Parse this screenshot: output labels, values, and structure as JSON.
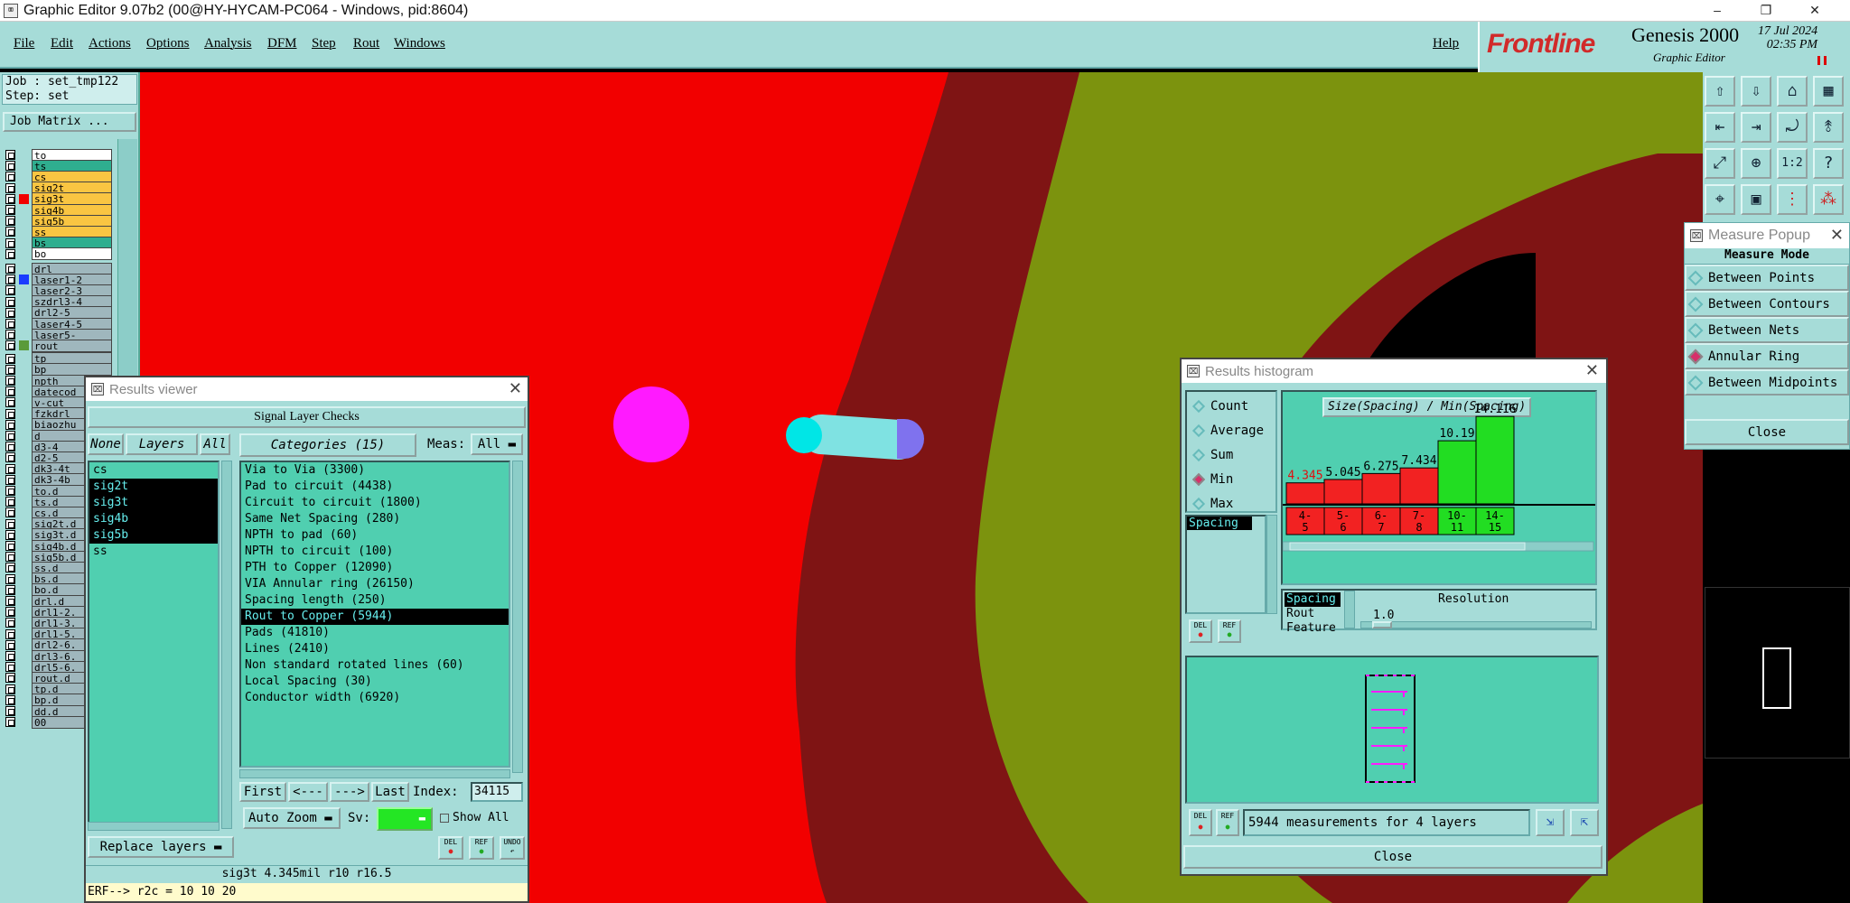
{
  "window": {
    "title": "Graphic Editor 9.07b2 (00@HY-HYCAM-PC064 - Windows, pid:8604)",
    "minimize": "–",
    "restore": "❐",
    "close": "✕"
  },
  "menu": [
    "File",
    "Edit",
    "Actions",
    "Options",
    "Analysis",
    "DFM",
    "Step",
    "Rout",
    "Windows"
  ],
  "help": "Help",
  "brand": {
    "logo": "Frontline",
    "product": "Genesis 2000",
    "subtitle": "Graphic Editor",
    "date": "17 Jul 2024",
    "time": "02:35 PM"
  },
  "job": {
    "job_line": "Job : set_tmp122",
    "step_line": "Step: set",
    "matrix_button": "Job Matrix ..."
  },
  "layers": [
    {
      "name": "to",
      "bg": "#ffffff",
      "color": ""
    },
    {
      "name": "ts",
      "bg": "#2fae8f",
      "color": ""
    },
    {
      "name": "cs",
      "bg": "#f9c542",
      "color": ""
    },
    {
      "name": "sig2t",
      "bg": "#f9c542",
      "color": ""
    },
    {
      "name": "sig3t",
      "bg": "#f9c542",
      "color": "#f20000"
    },
    {
      "name": "sig4b",
      "bg": "#f9c542",
      "color": ""
    },
    {
      "name": "sig5b",
      "bg": "#f9c542",
      "color": ""
    },
    {
      "name": "ss",
      "bg": "#f9c542",
      "color": ""
    },
    {
      "name": "bs",
      "bg": "#2fae8f",
      "color": ""
    },
    {
      "name": "bo",
      "bg": "#ffffff",
      "color": ""
    },
    {
      "name": "drl",
      "bg": "#9fb7bd",
      "color": ""
    },
    {
      "name": "laser1-2",
      "bg": "#9fb7bd",
      "color": "#1a3cff"
    },
    {
      "name": "laser2-3",
      "bg": "#9fb7bd",
      "color": ""
    },
    {
      "name": "szdrl3-4",
      "bg": "#9fb7bd",
      "color": ""
    },
    {
      "name": "drl2-5",
      "bg": "#9fb7bd",
      "color": ""
    },
    {
      "name": "laser4-5",
      "bg": "#9fb7bd",
      "color": ""
    },
    {
      "name": "laser5-",
      "bg": "#9fb7bd",
      "color": ""
    },
    {
      "name": "rout",
      "bg": "#9fb7bd",
      "color": "#5a9a3a"
    },
    {
      "name": "tp",
      "bg": "#9fb7bd",
      "color": ""
    },
    {
      "name": "bp",
      "bg": "#9fb7bd",
      "color": ""
    },
    {
      "name": "npth",
      "bg": "#9fb7bd",
      "color": ""
    },
    {
      "name": "datecod",
      "bg": "#9fb7bd",
      "color": ""
    },
    {
      "name": "v-cut",
      "bg": "#9fb7bd",
      "color": ""
    },
    {
      "name": "fzkdrl",
      "bg": "#9fb7bd",
      "color": ""
    },
    {
      "name": "biaozhu",
      "bg": "#9fb7bd",
      "color": ""
    },
    {
      "name": "d",
      "bg": "#9fb7bd",
      "color": ""
    },
    {
      "name": "d3-4",
      "bg": "#9fb7bd",
      "color": ""
    },
    {
      "name": "d2-5",
      "bg": "#9fb7bd",
      "color": ""
    },
    {
      "name": "dk3-4t",
      "bg": "#9fb7bd",
      "color": ""
    },
    {
      "name": "dk3-4b",
      "bg": "#9fb7bd",
      "color": ""
    },
    {
      "name": "to.d",
      "bg": "#9fb7bd",
      "color": ""
    },
    {
      "name": "ts.d",
      "bg": "#9fb7bd",
      "color": ""
    },
    {
      "name": "cs.d",
      "bg": "#9fb7bd",
      "color": ""
    },
    {
      "name": "sig2t.d",
      "bg": "#9fb7bd",
      "color": ""
    },
    {
      "name": "sig3t.d",
      "bg": "#9fb7bd",
      "color": ""
    },
    {
      "name": "sig4b.d",
      "bg": "#9fb7bd",
      "color": ""
    },
    {
      "name": "sig5b.d",
      "bg": "#9fb7bd",
      "color": ""
    },
    {
      "name": "ss.d",
      "bg": "#9fb7bd",
      "color": ""
    },
    {
      "name": "bs.d",
      "bg": "#9fb7bd",
      "color": ""
    },
    {
      "name": "bo.d",
      "bg": "#9fb7bd",
      "color": ""
    },
    {
      "name": "drl.d",
      "bg": "#9fb7bd",
      "color": ""
    },
    {
      "name": "drl1-2.",
      "bg": "#9fb7bd",
      "color": ""
    },
    {
      "name": "drl1-3.",
      "bg": "#9fb7bd",
      "color": ""
    },
    {
      "name": "drl1-5.",
      "bg": "#9fb7bd",
      "color": ""
    },
    {
      "name": "drl2-6.",
      "bg": "#9fb7bd",
      "color": ""
    },
    {
      "name": "drl3-6.",
      "bg": "#9fb7bd",
      "color": ""
    },
    {
      "name": "drl5-6.",
      "bg": "#9fb7bd",
      "color": ""
    },
    {
      "name": "rout.d",
      "bg": "#9fb7bd",
      "color": ""
    },
    {
      "name": "tp.d",
      "bg": "#9fb7bd",
      "color": ""
    },
    {
      "name": "bp.d",
      "bg": "#9fb7bd",
      "color": ""
    },
    {
      "name": "dd.d",
      "bg": "#9fb7bd",
      "color": ""
    },
    {
      "name": "00",
      "bg": "#9fb7bd",
      "color": ""
    }
  ],
  "results_viewer": {
    "title": "Results viewer",
    "section": "Signal Layer Checks",
    "none_btn": "None",
    "layers_btn": "Layers",
    "all_btn": "All",
    "categories_btn": "Categories (15)",
    "meas_label": "Meas:",
    "meas_value": "All",
    "layer_items": [
      {
        "name": "cs",
        "selected": false
      },
      {
        "name": "sig2t",
        "selected": true
      },
      {
        "name": "sig3t",
        "selected": true
      },
      {
        "name": "sig4b",
        "selected": true
      },
      {
        "name": "sig5b",
        "selected": true
      },
      {
        "name": "ss",
        "selected": false
      }
    ],
    "categories": [
      {
        "name": "Via to Via (3300)",
        "selected": false
      },
      {
        "name": "Pad to circuit (4438)",
        "selected": false
      },
      {
        "name": "Circuit to circuit (1800)",
        "selected": false
      },
      {
        "name": "Same Net Spacing (280)",
        "selected": false
      },
      {
        "name": "NPTH to pad (60)",
        "selected": false
      },
      {
        "name": "NPTH to circuit (100)",
        "selected": false
      },
      {
        "name": "PTH to Copper (12090)",
        "selected": false
      },
      {
        "name": "VIA Annular ring (26150)",
        "selected": false
      },
      {
        "name": "Spacing length (250)",
        "selected": false
      },
      {
        "name": "Rout to Copper (5944)",
        "selected": true
      },
      {
        "name": "Pads (41810)",
        "selected": false
      },
      {
        "name": "Lines (2410)",
        "selected": false
      },
      {
        "name": "Non standard rotated lines (60)",
        "selected": false
      },
      {
        "name": "Local Spacing (30)",
        "selected": false
      },
      {
        "name": "Conductor width (6920)",
        "selected": false
      }
    ],
    "first_btn": "First",
    "prev_btn": "<---",
    "next_btn": "--->",
    "last_btn": "Last",
    "index_label": "Index:",
    "index_value": "34115",
    "autozoom": "Auto Zoom",
    "sv_label": "Sv:",
    "show_all": "Show All",
    "replace_layers": "Replace layers",
    "del": "DEL",
    "ref": "REF",
    "undo": "UNDO",
    "status": "sig3t 4.345mil  r10  r16.5",
    "erf": "ERF--> r2c = 10 10 20"
  },
  "measure_popup": {
    "title": "Measure Popup",
    "mode_label": "Measure Mode",
    "options": [
      {
        "label": "Between Points",
        "on": false
      },
      {
        "label": "Between Contours",
        "on": false
      },
      {
        "label": "Between Nets",
        "on": false
      },
      {
        "label": "Annular Ring",
        "on": true
      },
      {
        "label": "Between Midpoints",
        "on": false
      }
    ],
    "close": "Close"
  },
  "histogram": {
    "title": "Results histogram",
    "stats": [
      {
        "label": "Count",
        "on": false
      },
      {
        "label": "Average",
        "on": false
      },
      {
        "label": "Sum",
        "on": false
      },
      {
        "label": "Min",
        "on": true
      },
      {
        "label": "Max",
        "on": false
      }
    ],
    "spacing_item": "Spacing",
    "chart_title": "Size(Spacing) / Min(Spacing)",
    "types": [
      "Spacing",
      "Rout",
      "Feature"
    ],
    "resolution_label": "Resolution",
    "resolution_value": "1.0",
    "summary": "5944 measurements for 4 layers",
    "close": "Close",
    "del": "DEL",
    "ref": "REF"
  },
  "chart_data": {
    "type": "bar",
    "title": "Size(Spacing) / Min(Spacing)",
    "categories": [
      "4-5",
      "5-6",
      "6-7",
      "7-8",
      "10-11",
      "14-15"
    ],
    "values": [
      4.345,
      5.045,
      6.275,
      7.434,
      10.19,
      14.116
    ],
    "value_labels": [
      "4.345",
      "5.045",
      "6.275",
      "7.434",
      "10.19",
      "14.116"
    ],
    "bin_labels": [
      [
        "4-",
        "5"
      ],
      [
        "5-",
        "6"
      ],
      [
        "6-",
        "7"
      ],
      [
        "7-",
        "8"
      ],
      [
        "10-",
        "11"
      ],
      [
        "14-",
        "15"
      ]
    ],
    "colors": [
      "#f22222",
      "#f22222",
      "#f22222",
      "#f22222",
      "#22dd22",
      "#22dd22"
    ],
    "ylim": [
      0,
      15
    ]
  }
}
